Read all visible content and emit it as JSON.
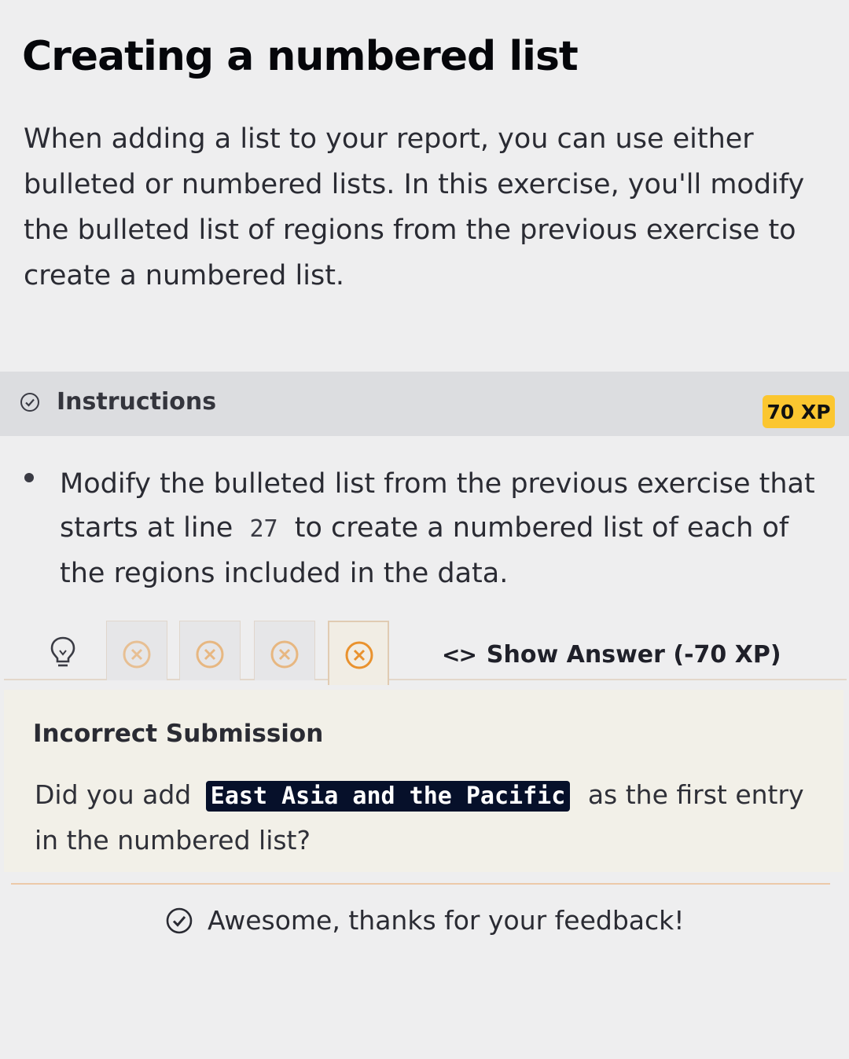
{
  "exercise": {
    "title": "Creating a numbered list",
    "description": "When adding a list to your report, you can use either bulleted or numbered lists. In this exercise, you'll modify the bulleted list of regions from the previous exercise to create a numbered list."
  },
  "instructions": {
    "header_label": "Instructions",
    "xp_badge": "70 XP",
    "task_before": "Modify the bulleted list from the previous exercise that starts at line",
    "task_code": "27",
    "task_after": "to create a numbered list of each of the regions included in the data."
  },
  "attempts_bar": {
    "hint_icon": "lightbulb-icon",
    "attempt_icon": "x-circle-icon",
    "attempt_count": 4,
    "show_answer_icon": "code-brackets-icon",
    "show_answer_label": "Show Answer (-70 XP)"
  },
  "feedback": {
    "title": "Incorrect Submission",
    "text_before": "Did you add",
    "code": "East Asia and the Pacific",
    "text_after": "as the first entry in the numbered list?",
    "thanks_icon": "check-circle-icon",
    "thanks_message": "Awesome, thanks for your feedback!"
  },
  "colors": {
    "xp_badge": "#fbc630",
    "attempt_icon": "#e9922e",
    "code_bg": "#06102a",
    "feedback_panel": "#f2f0e8"
  }
}
